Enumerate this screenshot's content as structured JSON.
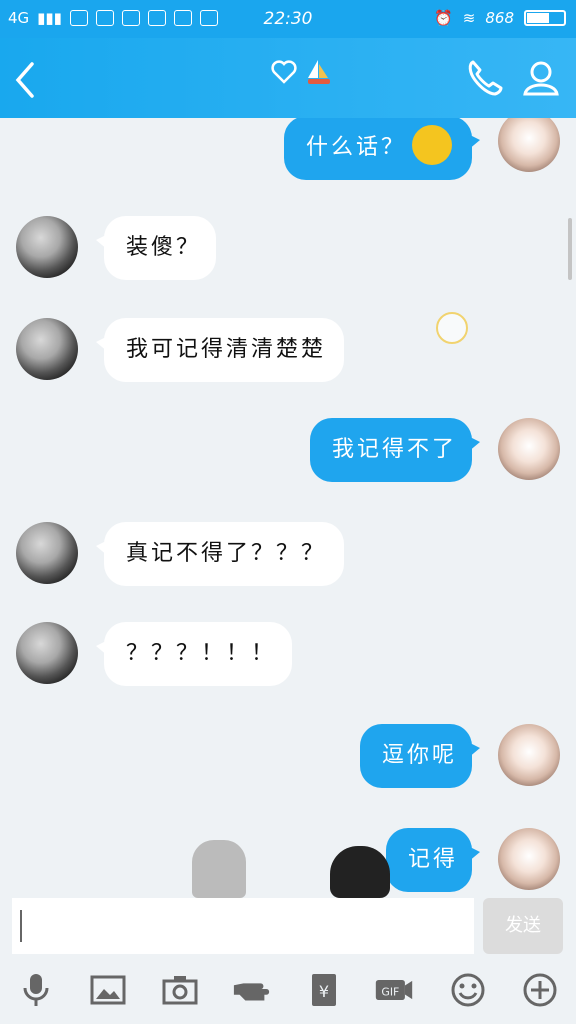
{
  "status_bar": {
    "network": "4G",
    "time": "22:30",
    "battery_text": "868"
  },
  "header": {
    "title_icons": [
      "heart-icon",
      "sailboat-icon"
    ],
    "accent": "#1aa6ee"
  },
  "messages": [
    {
      "side": "self",
      "text": "什么话？"
    },
    {
      "side": "friend",
      "text": "装傻？"
    },
    {
      "side": "friend",
      "text": "我可记得清清楚楚"
    },
    {
      "side": "self",
      "text": "我记得不了"
    },
    {
      "side": "friend",
      "text": "真记不得了？？？"
    },
    {
      "side": "friend",
      "text": "？？？！！！"
    },
    {
      "side": "self",
      "text": "逗你呢"
    },
    {
      "side": "self",
      "text": "记得"
    }
  ],
  "composer": {
    "value": "",
    "send_label": "发送"
  },
  "toolbar_icons": [
    "microphone-icon",
    "image-icon",
    "camera-icon",
    "hand-icon",
    "red-packet-icon",
    "gif-icon",
    "emoji-icon",
    "plus-icon"
  ]
}
